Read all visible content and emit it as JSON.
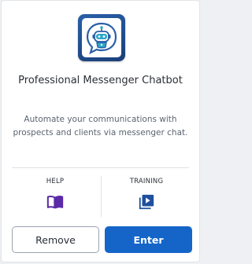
{
  "app": {
    "title": "Professional Messenger Chatbot",
    "description": "Automate your communications with prospects and clients via messenger chat.",
    "logo_icon": "chatbot-robot-icon"
  },
  "links": {
    "help": {
      "label": "HELP",
      "icon": "book-icon"
    },
    "training": {
      "label": "TRAINING",
      "icon": "video-library-icon"
    }
  },
  "buttons": {
    "remove_label": "Remove",
    "enter_label": "Enter"
  },
  "colors": {
    "accent": "#1565c9",
    "icon_purple": "#5b2aa8",
    "logo_blue": "#2a5fa8",
    "robot_teal": "#2fa8c9"
  }
}
